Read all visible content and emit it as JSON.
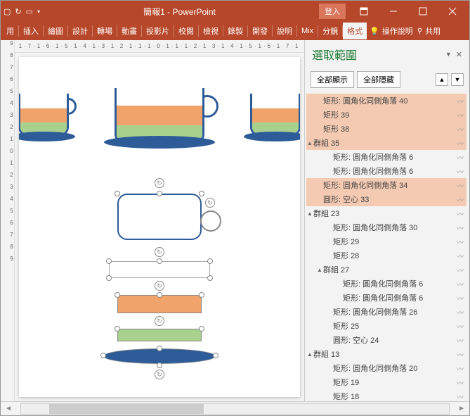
{
  "titlebar": {
    "title": "簡報1 - PowerPoint",
    "login": "登入"
  },
  "ribbon": {
    "tabs": [
      "用",
      "插入",
      "繪圖",
      "設計",
      "轉場",
      "動畫",
      "投影片",
      "校閱",
      "檢視",
      "錄製",
      "開發",
      "說明",
      "Mix",
      "分鏡",
      "格式"
    ],
    "active_index": 14,
    "tell_me": "操作說明",
    "share": "共用"
  },
  "hruler": "1·7·1·6·1·5·1·4·1·3·1·2·1·1·1·0·1·1·1·2·1·3·1·4·1·5·1·6·1·7·1",
  "pane": {
    "title": "選取範圍",
    "show_all": "全部顯示",
    "hide_all": "全部隱藏",
    "items": [
      {
        "lvl": 1,
        "label": "矩形: 圓角化同側角落 40",
        "sel": true,
        "tw": ""
      },
      {
        "lvl": 1,
        "label": "矩形 39",
        "sel": true,
        "tw": ""
      },
      {
        "lvl": 1,
        "label": "矩形 38",
        "sel": true,
        "tw": ""
      },
      {
        "lvl": 0,
        "label": "群組 35",
        "sel": true,
        "tw": "▲"
      },
      {
        "lvl": 2,
        "label": "矩形: 圓角化同側角落 6",
        "sel": false,
        "tw": ""
      },
      {
        "lvl": 2,
        "label": "矩形: 圓角化同側角落 6",
        "sel": false,
        "tw": ""
      },
      {
        "lvl": 1,
        "label": "矩形: 圓角化同側角落 34",
        "sel": true,
        "tw": ""
      },
      {
        "lvl": 1,
        "label": "圓形: 空心 33",
        "sel": true,
        "tw": ""
      },
      {
        "lvl": 0,
        "label": "群組 23",
        "sel": false,
        "tw": "▲"
      },
      {
        "lvl": 2,
        "label": "矩形: 圓角化同側角落 30",
        "sel": false,
        "tw": ""
      },
      {
        "lvl": 2,
        "label": "矩形 29",
        "sel": false,
        "tw": ""
      },
      {
        "lvl": 2,
        "label": "矩形 28",
        "sel": false,
        "tw": ""
      },
      {
        "lvl": 1,
        "label": "群組 27",
        "sel": false,
        "tw": "▲"
      },
      {
        "lvl": 3,
        "label": "矩形: 圓角化同側角落 6",
        "sel": false,
        "tw": ""
      },
      {
        "lvl": 3,
        "label": "矩形: 圓角化同側角落 6",
        "sel": false,
        "tw": ""
      },
      {
        "lvl": 2,
        "label": "矩形: 圓角化同側角落 26",
        "sel": false,
        "tw": ""
      },
      {
        "lvl": 2,
        "label": "矩形 25",
        "sel": false,
        "tw": ""
      },
      {
        "lvl": 2,
        "label": "圓形: 空心 24",
        "sel": false,
        "tw": ""
      },
      {
        "lvl": 0,
        "label": "群組 13",
        "sel": false,
        "tw": "▲"
      },
      {
        "lvl": 2,
        "label": "矩形: 圓角化同側角落 20",
        "sel": false,
        "tw": ""
      },
      {
        "lvl": 2,
        "label": "矩形 19",
        "sel": false,
        "tw": ""
      },
      {
        "lvl": 2,
        "label": "矩形 18",
        "sel": false,
        "tw": ""
      }
    ]
  }
}
